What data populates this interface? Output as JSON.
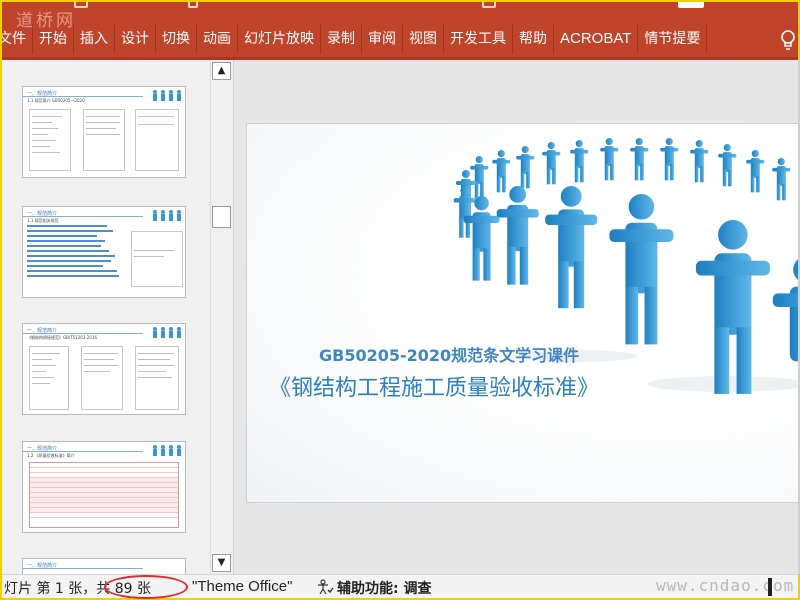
{
  "watermark_top": "道桥网",
  "ribbon": {
    "tabs": [
      {
        "key": "file",
        "label": "文件"
      },
      {
        "key": "home",
        "label": "开始"
      },
      {
        "key": "insert",
        "label": "插入"
      },
      {
        "key": "design",
        "label": "设计"
      },
      {
        "key": "transitions",
        "label": "切换"
      },
      {
        "key": "animations",
        "label": "动画"
      },
      {
        "key": "slideshow",
        "label": "幻灯片放映"
      },
      {
        "key": "record",
        "label": "录制"
      },
      {
        "key": "review",
        "label": "审阅"
      },
      {
        "key": "view",
        "label": "视图"
      },
      {
        "key": "developer",
        "label": "开发工具"
      },
      {
        "key": "help",
        "label": "帮助"
      },
      {
        "key": "acrobat",
        "label": "ACROBAT"
      },
      {
        "key": "storyboard",
        "label": "情节提要"
      }
    ],
    "tip_icon": "lightbulb-icon"
  },
  "thumbnails": {
    "scroll_up_icon": "triangle-up-icon",
    "scroll_down_icon": "triangle-down-icon"
  },
  "slide": {
    "subtitle": "GB50205-2020规范条文学习课件",
    "title": "《钢结构工程施工质量验收标准》"
  },
  "statusbar": {
    "slide_count": "灯片 第 1 张，共 89 张",
    "theme": "\"Theme Office\"",
    "accessibility": "辅助功能: 调查",
    "accessibility_icon": "accessibility-check-icon",
    "watermark": "www.cndao.com"
  },
  "colors": {
    "ribbon": "#c0442a",
    "slide_blue": "#2d7fc2",
    "annotation_red": "#e02b2b",
    "frame_yellow": "#f2d000"
  }
}
